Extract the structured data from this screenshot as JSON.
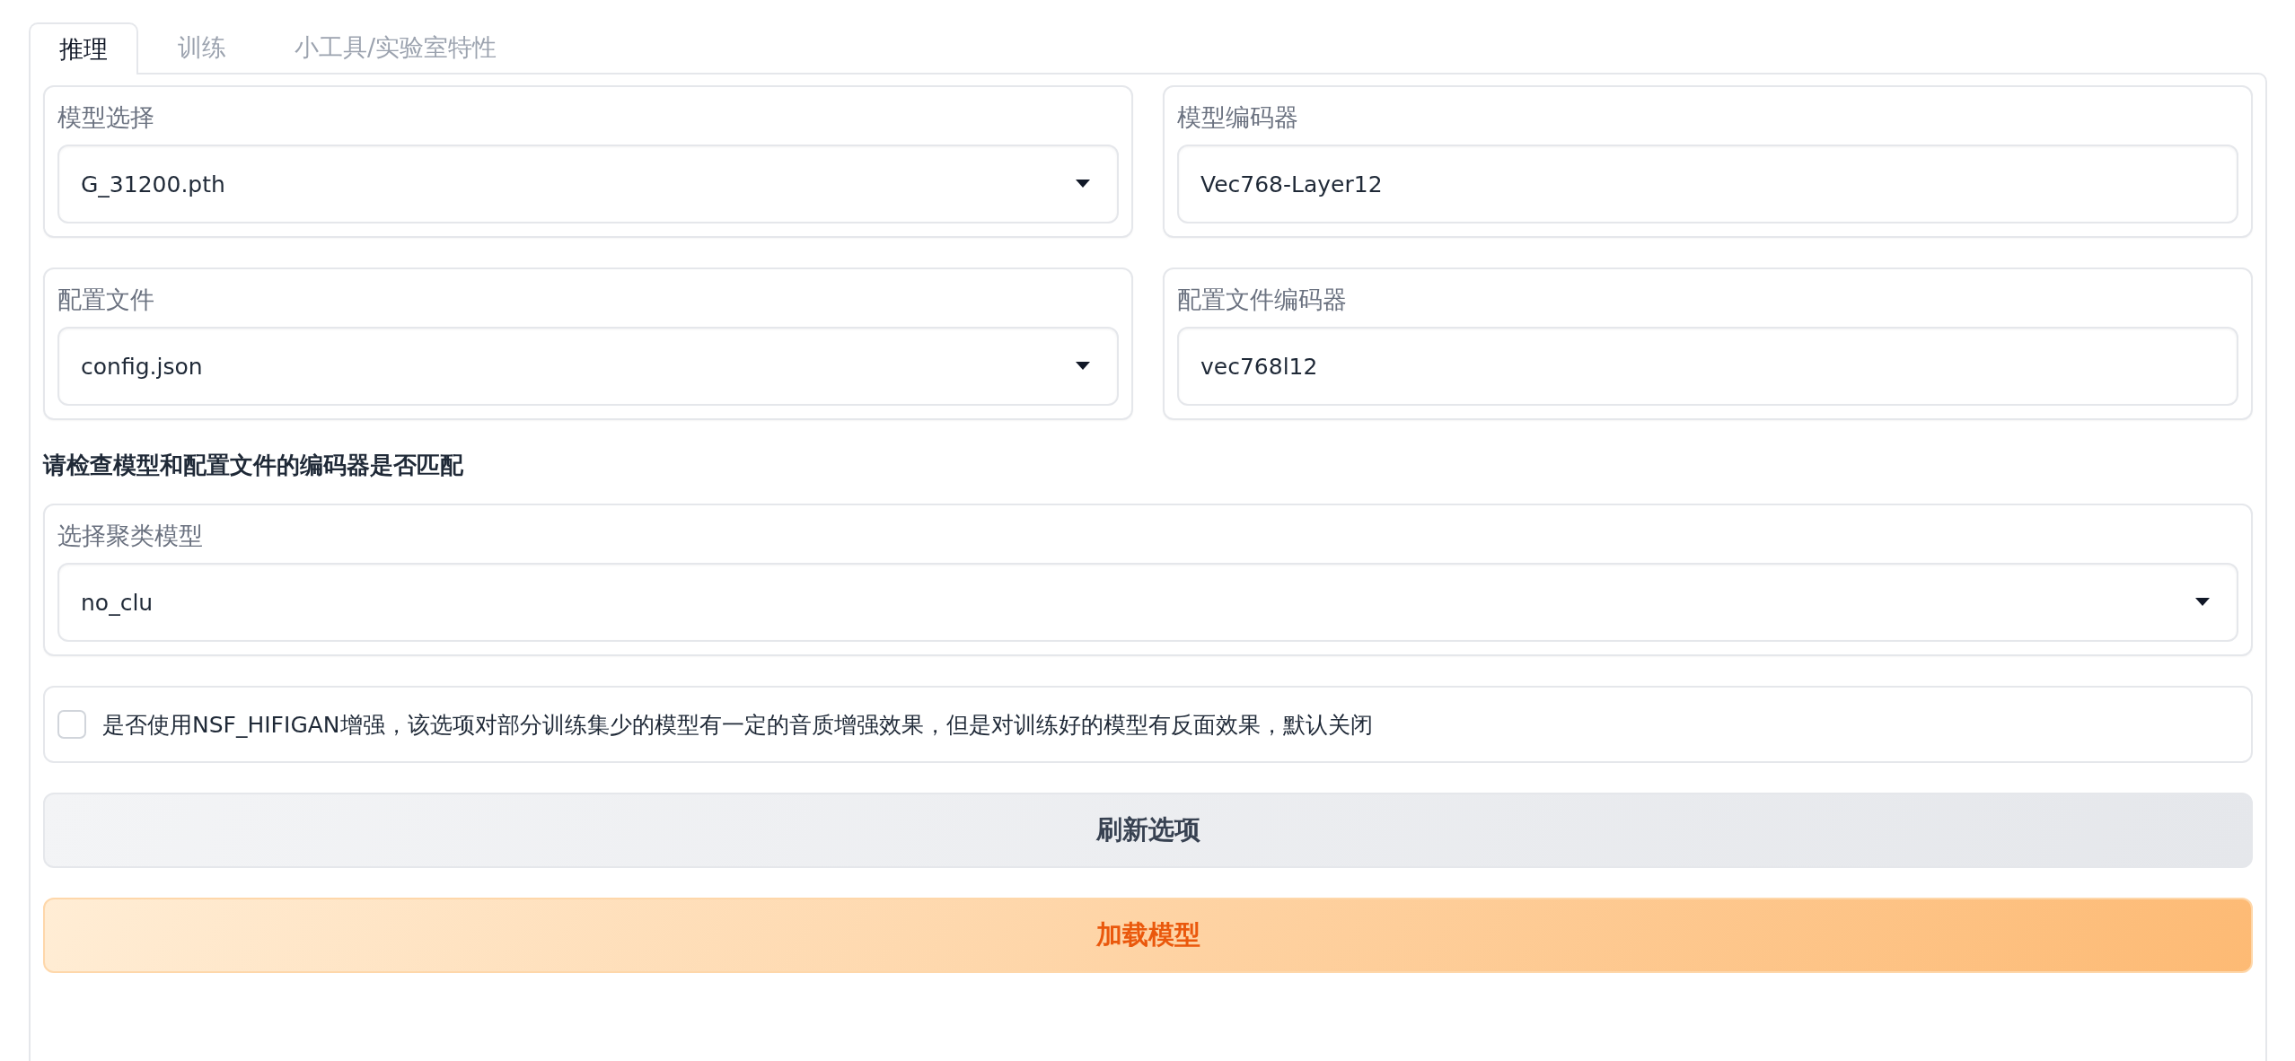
{
  "tabs": [
    {
      "label": "推理",
      "selected": true
    },
    {
      "label": "训练",
      "selected": false
    },
    {
      "label": "小工具/实验室特性",
      "selected": false
    }
  ],
  "model_rows": [
    [
      {
        "label": "模型选择",
        "kind": "dropdown",
        "value": "G_31200.pth"
      },
      {
        "label": "模型编码器",
        "kind": "text",
        "value": "Vec768-Layer12"
      }
    ],
    [
      {
        "label": "配置文件",
        "kind": "dropdown",
        "value": "config.json"
      },
      {
        "label": "配置文件编码器",
        "kind": "text",
        "value": "vec768l12"
      }
    ]
  ],
  "notice": "请检查模型和配置文件的编码器是否匹配",
  "cluster_model": {
    "label": "选择聚类模型",
    "kind": "dropdown",
    "value": "no_clu"
  },
  "nsf_hifigan": {
    "label": "是否使用NSF_HIFIGAN增强，该选项对部分训练集少的模型有一定的音质增强效果，但是对训练好的模型有反面效果，默认关闭",
    "checked": false
  },
  "buttons": [
    {
      "label": "刷新选项",
      "kind": "secondary"
    },
    {
      "label": "加载模型",
      "kind": "primary"
    }
  ]
}
